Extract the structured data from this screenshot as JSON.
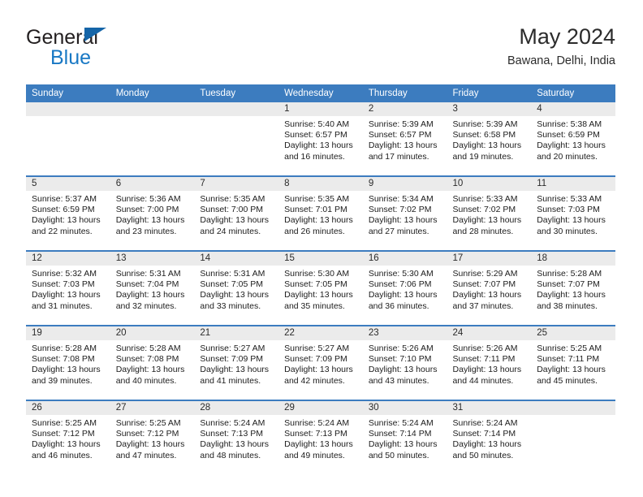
{
  "brand": {
    "name_top": "General",
    "name_bottom": "Blue",
    "color_dark": "#231f20",
    "color_blue": "#1878c4",
    "flag_icon": "triangle-flag-icon"
  },
  "header": {
    "title": "May 2024",
    "location": "Bawana, Delhi, India",
    "accent_color": "#3c7cbf",
    "band_color": "#ebebeb"
  },
  "columns": [
    "Sunday",
    "Monday",
    "Tuesday",
    "Wednesday",
    "Thursday",
    "Friday",
    "Saturday"
  ],
  "weeks": [
    [
      {
        "day": "",
        "sunrise": "",
        "sunset": "",
        "daylight_line1": "",
        "daylight_line2": ""
      },
      {
        "day": "",
        "sunrise": "",
        "sunset": "",
        "daylight_line1": "",
        "daylight_line2": ""
      },
      {
        "day": "",
        "sunrise": "",
        "sunset": "",
        "daylight_line1": "",
        "daylight_line2": ""
      },
      {
        "day": "1",
        "sunrise": "Sunrise: 5:40 AM",
        "sunset": "Sunset: 6:57 PM",
        "daylight_line1": "Daylight: 13 hours",
        "daylight_line2": "and 16 minutes."
      },
      {
        "day": "2",
        "sunrise": "Sunrise: 5:39 AM",
        "sunset": "Sunset: 6:57 PM",
        "daylight_line1": "Daylight: 13 hours",
        "daylight_line2": "and 17 minutes."
      },
      {
        "day": "3",
        "sunrise": "Sunrise: 5:39 AM",
        "sunset": "Sunset: 6:58 PM",
        "daylight_line1": "Daylight: 13 hours",
        "daylight_line2": "and 19 minutes."
      },
      {
        "day": "4",
        "sunrise": "Sunrise: 5:38 AM",
        "sunset": "Sunset: 6:59 PM",
        "daylight_line1": "Daylight: 13 hours",
        "daylight_line2": "and 20 minutes."
      }
    ],
    [
      {
        "day": "5",
        "sunrise": "Sunrise: 5:37 AM",
        "sunset": "Sunset: 6:59 PM",
        "daylight_line1": "Daylight: 13 hours",
        "daylight_line2": "and 22 minutes."
      },
      {
        "day": "6",
        "sunrise": "Sunrise: 5:36 AM",
        "sunset": "Sunset: 7:00 PM",
        "daylight_line1": "Daylight: 13 hours",
        "daylight_line2": "and 23 minutes."
      },
      {
        "day": "7",
        "sunrise": "Sunrise: 5:35 AM",
        "sunset": "Sunset: 7:00 PM",
        "daylight_line1": "Daylight: 13 hours",
        "daylight_line2": "and 24 minutes."
      },
      {
        "day": "8",
        "sunrise": "Sunrise: 5:35 AM",
        "sunset": "Sunset: 7:01 PM",
        "daylight_line1": "Daylight: 13 hours",
        "daylight_line2": "and 26 minutes."
      },
      {
        "day": "9",
        "sunrise": "Sunrise: 5:34 AM",
        "sunset": "Sunset: 7:02 PM",
        "daylight_line1": "Daylight: 13 hours",
        "daylight_line2": "and 27 minutes."
      },
      {
        "day": "10",
        "sunrise": "Sunrise: 5:33 AM",
        "sunset": "Sunset: 7:02 PM",
        "daylight_line1": "Daylight: 13 hours",
        "daylight_line2": "and 28 minutes."
      },
      {
        "day": "11",
        "sunrise": "Sunrise: 5:33 AM",
        "sunset": "Sunset: 7:03 PM",
        "daylight_line1": "Daylight: 13 hours",
        "daylight_line2": "and 30 minutes."
      }
    ],
    [
      {
        "day": "12",
        "sunrise": "Sunrise: 5:32 AM",
        "sunset": "Sunset: 7:03 PM",
        "daylight_line1": "Daylight: 13 hours",
        "daylight_line2": "and 31 minutes."
      },
      {
        "day": "13",
        "sunrise": "Sunrise: 5:31 AM",
        "sunset": "Sunset: 7:04 PM",
        "daylight_line1": "Daylight: 13 hours",
        "daylight_line2": "and 32 minutes."
      },
      {
        "day": "14",
        "sunrise": "Sunrise: 5:31 AM",
        "sunset": "Sunset: 7:05 PM",
        "daylight_line1": "Daylight: 13 hours",
        "daylight_line2": "and 33 minutes."
      },
      {
        "day": "15",
        "sunrise": "Sunrise: 5:30 AM",
        "sunset": "Sunset: 7:05 PM",
        "daylight_line1": "Daylight: 13 hours",
        "daylight_line2": "and 35 minutes."
      },
      {
        "day": "16",
        "sunrise": "Sunrise: 5:30 AM",
        "sunset": "Sunset: 7:06 PM",
        "daylight_line1": "Daylight: 13 hours",
        "daylight_line2": "and 36 minutes."
      },
      {
        "day": "17",
        "sunrise": "Sunrise: 5:29 AM",
        "sunset": "Sunset: 7:07 PM",
        "daylight_line1": "Daylight: 13 hours",
        "daylight_line2": "and 37 minutes."
      },
      {
        "day": "18",
        "sunrise": "Sunrise: 5:28 AM",
        "sunset": "Sunset: 7:07 PM",
        "daylight_line1": "Daylight: 13 hours",
        "daylight_line2": "and 38 minutes."
      }
    ],
    [
      {
        "day": "19",
        "sunrise": "Sunrise: 5:28 AM",
        "sunset": "Sunset: 7:08 PM",
        "daylight_line1": "Daylight: 13 hours",
        "daylight_line2": "and 39 minutes."
      },
      {
        "day": "20",
        "sunrise": "Sunrise: 5:28 AM",
        "sunset": "Sunset: 7:08 PM",
        "daylight_line1": "Daylight: 13 hours",
        "daylight_line2": "and 40 minutes."
      },
      {
        "day": "21",
        "sunrise": "Sunrise: 5:27 AM",
        "sunset": "Sunset: 7:09 PM",
        "daylight_line1": "Daylight: 13 hours",
        "daylight_line2": "and 41 minutes."
      },
      {
        "day": "22",
        "sunrise": "Sunrise: 5:27 AM",
        "sunset": "Sunset: 7:09 PM",
        "daylight_line1": "Daylight: 13 hours",
        "daylight_line2": "and 42 minutes."
      },
      {
        "day": "23",
        "sunrise": "Sunrise: 5:26 AM",
        "sunset": "Sunset: 7:10 PM",
        "daylight_line1": "Daylight: 13 hours",
        "daylight_line2": "and 43 minutes."
      },
      {
        "day": "24",
        "sunrise": "Sunrise: 5:26 AM",
        "sunset": "Sunset: 7:11 PM",
        "daylight_line1": "Daylight: 13 hours",
        "daylight_line2": "and 44 minutes."
      },
      {
        "day": "25",
        "sunrise": "Sunrise: 5:25 AM",
        "sunset": "Sunset: 7:11 PM",
        "daylight_line1": "Daylight: 13 hours",
        "daylight_line2": "and 45 minutes."
      }
    ],
    [
      {
        "day": "26",
        "sunrise": "Sunrise: 5:25 AM",
        "sunset": "Sunset: 7:12 PM",
        "daylight_line1": "Daylight: 13 hours",
        "daylight_line2": "and 46 minutes."
      },
      {
        "day": "27",
        "sunrise": "Sunrise: 5:25 AM",
        "sunset": "Sunset: 7:12 PM",
        "daylight_line1": "Daylight: 13 hours",
        "daylight_line2": "and 47 minutes."
      },
      {
        "day": "28",
        "sunrise": "Sunrise: 5:24 AM",
        "sunset": "Sunset: 7:13 PM",
        "daylight_line1": "Daylight: 13 hours",
        "daylight_line2": "and 48 minutes."
      },
      {
        "day": "29",
        "sunrise": "Sunrise: 5:24 AM",
        "sunset": "Sunset: 7:13 PM",
        "daylight_line1": "Daylight: 13 hours",
        "daylight_line2": "and 49 minutes."
      },
      {
        "day": "30",
        "sunrise": "Sunrise: 5:24 AM",
        "sunset": "Sunset: 7:14 PM",
        "daylight_line1": "Daylight: 13 hours",
        "daylight_line2": "and 50 minutes."
      },
      {
        "day": "31",
        "sunrise": "Sunrise: 5:24 AM",
        "sunset": "Sunset: 7:14 PM",
        "daylight_line1": "Daylight: 13 hours",
        "daylight_line2": "and 50 minutes."
      },
      {
        "day": "",
        "sunrise": "",
        "sunset": "",
        "daylight_line1": "",
        "daylight_line2": ""
      }
    ]
  ]
}
